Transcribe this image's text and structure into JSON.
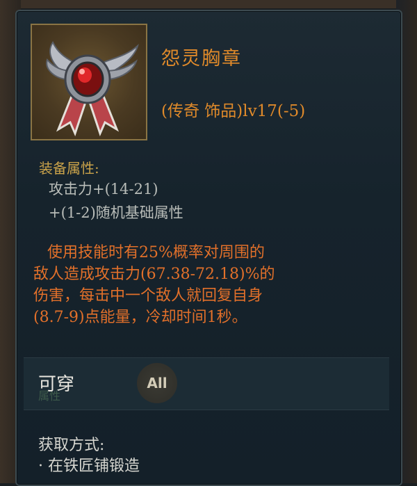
{
  "item": {
    "name": "怨灵胸章",
    "type_line": "(传奇 饰品)lv17(-5)",
    "icon": "amulet-icon"
  },
  "attributes": {
    "header": "装备属性:",
    "lines": [
      "攻击力+(14-21)",
      "+(1-2)随机基础属性"
    ]
  },
  "effect": {
    "lines": [
      "使用技能时有25%概率对周围的",
      "敌人造成攻击力(67.38-72.18)%的",
      "伤害，每击中一个敌人就回复自身",
      "(8.7-9)点能量，冷却时间1秒。"
    ]
  },
  "wearable": {
    "label": "可穿",
    "badge": "All",
    "ghost_text": "属性"
  },
  "obtain": {
    "header": "获取方式:",
    "items": [
      "· 在铁匠铺锻造"
    ]
  },
  "colors": {
    "legendary": "#e08a2a",
    "attr_header": "#c9a24a",
    "effect": "#e2702a"
  }
}
